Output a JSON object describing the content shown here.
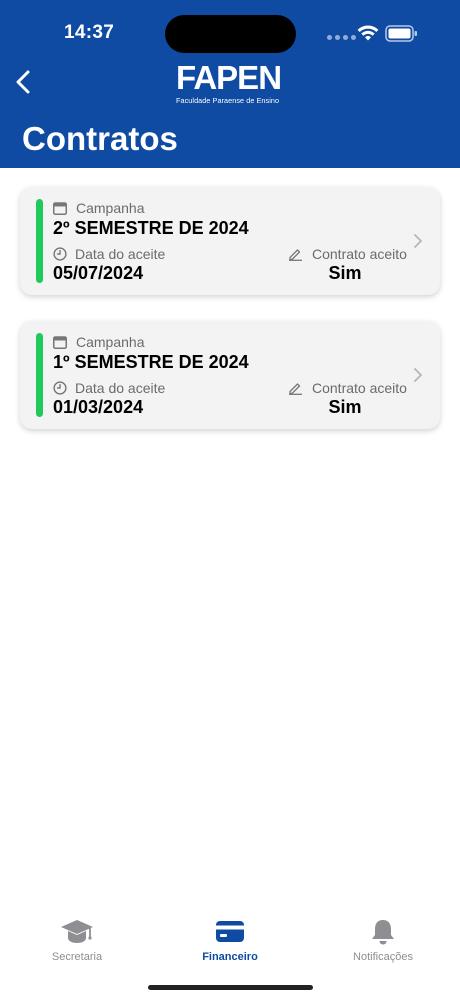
{
  "status_bar": {
    "time": "14:37"
  },
  "header": {
    "logo_text": "FAPEN",
    "logo_subtitle": "Faculdade Paraense de Ensino",
    "title": "Contratos"
  },
  "contracts": [
    {
      "campaign_label": "Campanha",
      "semester": "2º SEMESTRE DE 2024",
      "date_label": "Data do aceite",
      "date": "05/07/2024",
      "contract_label": "Contrato aceito",
      "contract_value": "Sim"
    },
    {
      "campaign_label": "Campanha",
      "semester": "1º SEMESTRE DE 2024",
      "date_label": "Data do aceite",
      "date": "01/03/2024",
      "contract_label": "Contrato aceito",
      "contract_value": "Sim"
    }
  ],
  "tabbar": {
    "items": [
      {
        "label": "Secretaria",
        "icon": "graduation-cap-icon"
      },
      {
        "label": "Financeiro",
        "icon": "credit-card-icon",
        "active": true
      },
      {
        "label": "Notificações",
        "icon": "bell-icon"
      }
    ]
  },
  "colors": {
    "brand": "#0f4aa3",
    "status_bar_accent": "#1fc95a",
    "card_bg": "#f3f3f3",
    "inactive_tab": "#8e8e93"
  }
}
